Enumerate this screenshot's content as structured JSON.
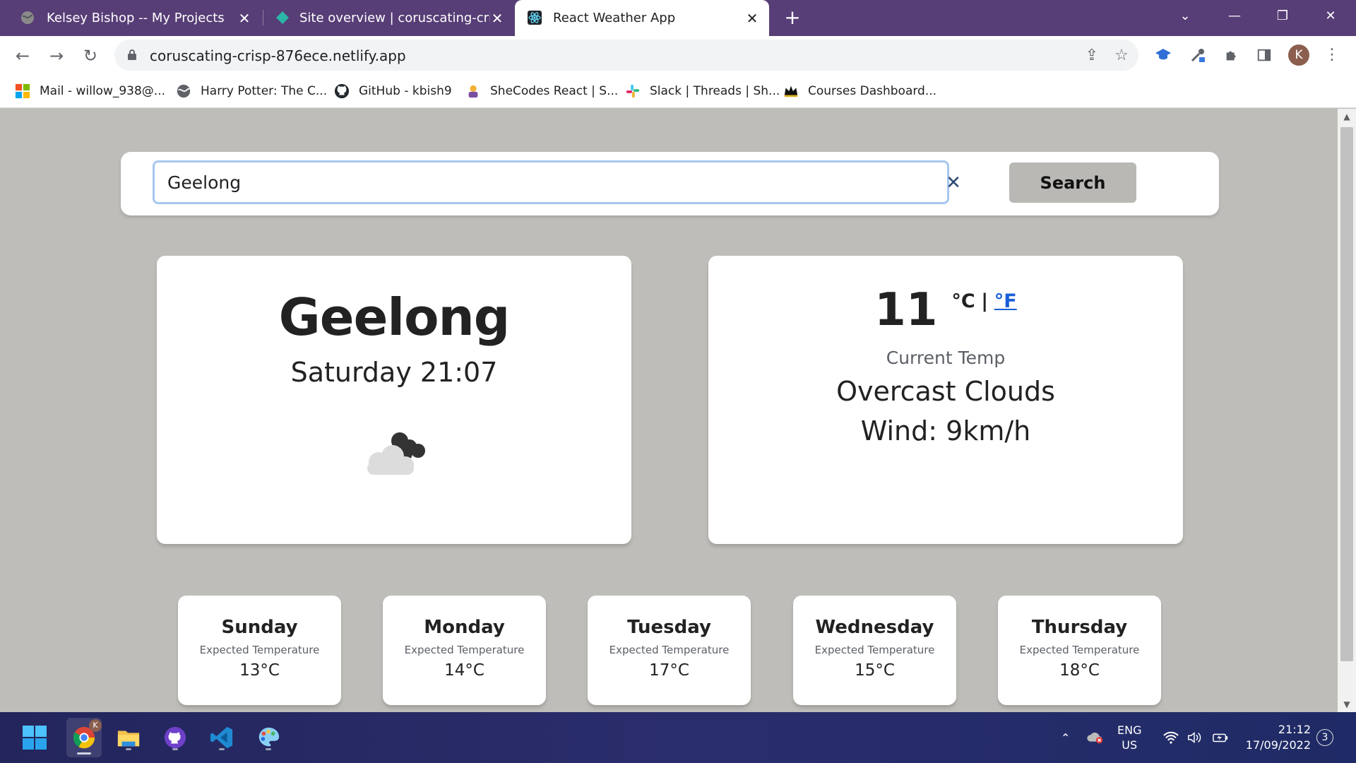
{
  "browser": {
    "tabs": [
      {
        "title": "Kelsey Bishop -- My Projects",
        "active": false
      },
      {
        "title": "Site overview | coruscating-crisp-",
        "active": false
      },
      {
        "title": "React Weather App",
        "active": true
      }
    ],
    "url": "coruscating-crisp-876ece.netlify.app",
    "profile_initial": "K",
    "bookmarks": [
      {
        "label": "Mail - willow_938@...",
        "icon": "microsoft-icon"
      },
      {
        "label": "Harry Potter: The C...",
        "icon": "globe-icon"
      },
      {
        "label": "GitHub - kbish9",
        "icon": "github-icon"
      },
      {
        "label": "SheCodes React | S...",
        "icon": "shecodes-icon"
      },
      {
        "label": "Slack | Threads | Sh...",
        "icon": "slack-icon"
      },
      {
        "label": "Courses Dashboard...",
        "icon": "crown-icon"
      }
    ]
  },
  "search": {
    "value": "Geelong",
    "button_label": "Search"
  },
  "current": {
    "city": "Geelong",
    "datetime": "Saturday 21:07",
    "icon": "overcast-clouds-icon",
    "temperature": "11",
    "unit_celsius": "°C",
    "unit_separator": "|",
    "unit_fahrenheit": "°F",
    "temp_label": "Current Temp",
    "description": "Overcast Clouds",
    "wind": "Wind: 9km/h"
  },
  "forecast": [
    {
      "day": "Sunday",
      "label": "Expected Temperature",
      "temp": "13°C"
    },
    {
      "day": "Monday",
      "label": "Expected Temperature",
      "temp": "14°C"
    },
    {
      "day": "Tuesday",
      "label": "Expected Temperature",
      "temp": "17°C"
    },
    {
      "day": "Wednesday",
      "label": "Expected Temperature",
      "temp": "15°C"
    },
    {
      "day": "Thursday",
      "label": "Expected Temperature",
      "temp": "18°C"
    }
  ],
  "taskbar": {
    "lang_top": "ENG",
    "lang_bottom": "US",
    "time": "21:12",
    "date": "17/09/2022",
    "notifications": "3",
    "chrome_badge": "K"
  },
  "colors": {
    "tabbar": "#573e76",
    "page_background": "#bfbdb9",
    "fahrenheit_link": "#1a5fd8",
    "search_focus": "#a7c7ef"
  }
}
